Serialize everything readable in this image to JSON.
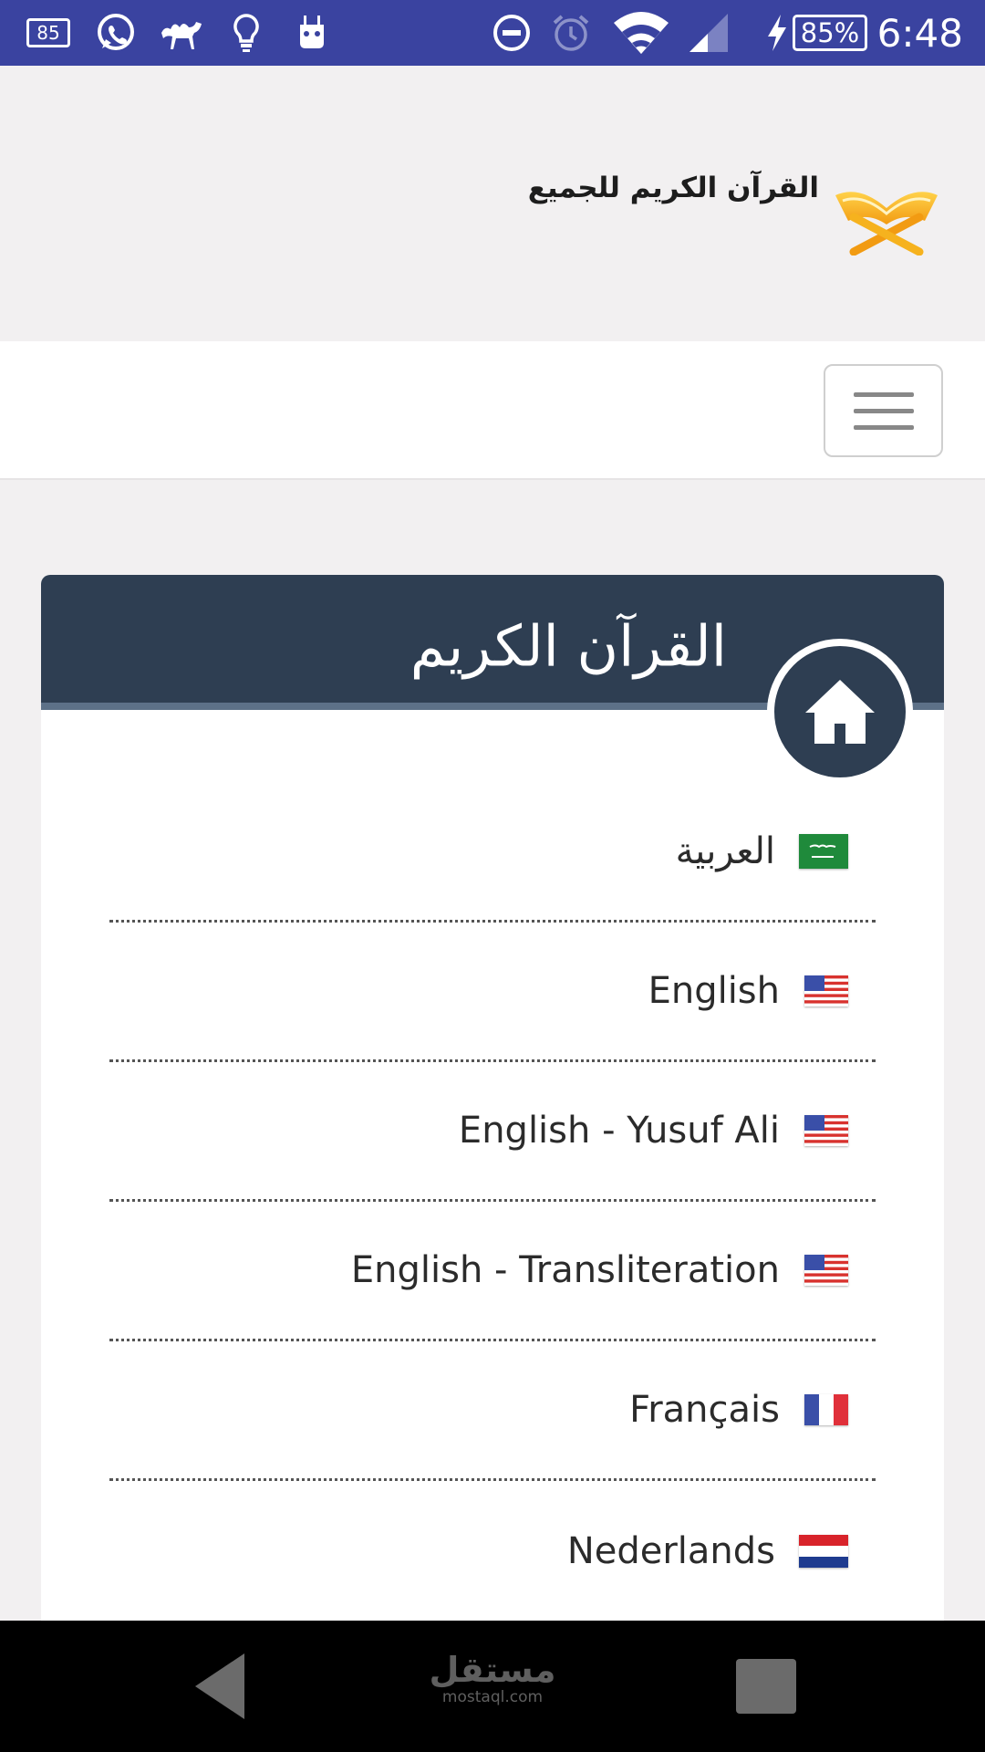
{
  "status_bar": {
    "notification_badge": "85",
    "battery_percent": "85%",
    "time": "6:48",
    "icons": [
      "battery-notification-icon",
      "whatsapp-icon",
      "camel-icon",
      "lightbulb-icon",
      "android-icon",
      "do-not-disturb-icon",
      "alarm-icon",
      "wifi-icon",
      "signal-icon",
      "charging-icon"
    ]
  },
  "header": {
    "logo_text": "القرآن الكريم للجميع"
  },
  "card": {
    "title": "القرآن الكريم"
  },
  "languages": [
    {
      "label": "العربية",
      "flag": "saudi-arabia-flag"
    },
    {
      "label": "English",
      "flag": "usa-flag"
    },
    {
      "label": "English - Yusuf Ali",
      "flag": "usa-flag"
    },
    {
      "label": "English - Transliteration",
      "flag": "usa-flag"
    },
    {
      "label": "Français",
      "flag": "france-flag"
    },
    {
      "label": "Nederlands",
      "flag": "netherlands-flag"
    }
  ],
  "watermark": {
    "arabic": "مستقل",
    "url": "mostaql.com"
  },
  "colors": {
    "status_bar": "#3a43a0",
    "card_header": "#2e3e52",
    "logo_gold": "#f2a81d"
  }
}
